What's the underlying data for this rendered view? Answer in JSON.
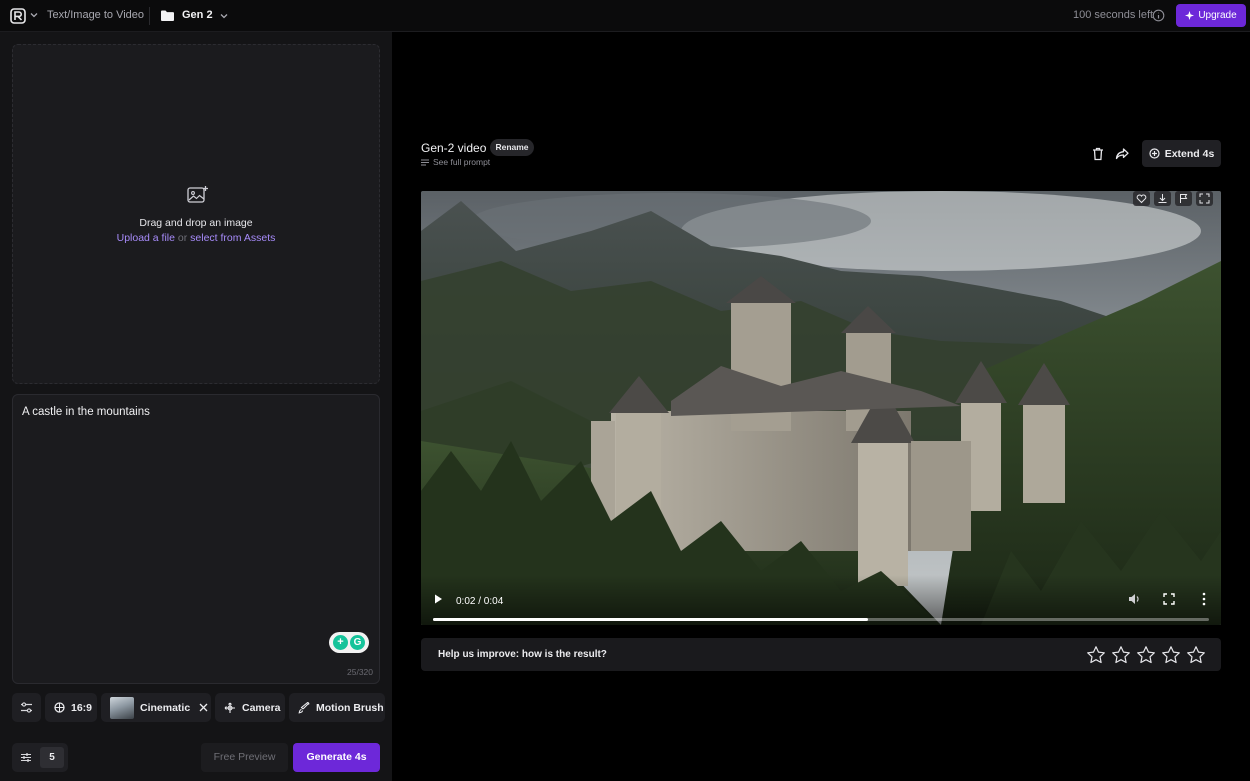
{
  "topbar": {
    "nav_title": "Text/Image to Video",
    "project_name": "Gen 2",
    "credits": "100 seconds left",
    "upgrade_label": "Upgrade"
  },
  "left": {
    "drop": {
      "title": "Drag and drop an image",
      "upload_link": "Upload a file",
      "or_text": "or",
      "assets_link": "select from Assets"
    },
    "prompt": {
      "value": "A castle in the mountains",
      "char_count": "25/320"
    },
    "options": {
      "aspect_ratio": "16:9",
      "style": "Cinematic",
      "camera": "Camera",
      "motion_brush": "Motion Brush"
    },
    "bottom": {
      "count": "5",
      "free_preview": "Free Preview",
      "generate": "Generate 4s"
    }
  },
  "video_panel": {
    "title": "Gen-2 video",
    "rename": "Rename",
    "see_prompt": "See full prompt",
    "extend": "Extend 4s",
    "player": {
      "time": "0:02 / 0:04",
      "progress_fraction": 0.56
    },
    "feedback": {
      "question": "Help us improve: how is the result?",
      "star_count": 5
    }
  },
  "colors": {
    "accent": "#6d28d9",
    "link": "#a78bfa"
  }
}
